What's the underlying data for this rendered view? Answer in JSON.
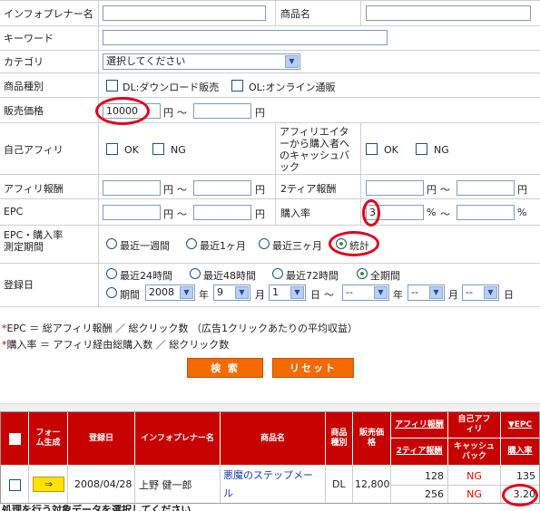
{
  "form": {
    "infopreneur_label": "インフォプレナー名",
    "product_label": "商品名",
    "keyword_label": "キーワード",
    "category_label": "カテゴリ",
    "category_value": "選択してください",
    "product_type_label": "商品種別",
    "product_type_dl": "DL:ダウンロード販売",
    "product_type_ol": "OL:オンライン通販",
    "price_label": "販売価格",
    "price_min": "10000",
    "yen": "円",
    "tilde": "〜",
    "self_affiliate_label": "自己アフィリ",
    "ok": "OK",
    "ng": "NG",
    "cashback_label": "アフィリエイターから購入者へのキャッシュバック",
    "affiliate_reward_label": "アフィリ報酬",
    "tier2_label": "2ティア報酬",
    "epc_label": "EPC",
    "purchase_rate_label": "購入率",
    "purchase_rate_min": "3",
    "percent": "%",
    "period_label": "EPC・購入率測定期間",
    "period_options": [
      "最近一週間",
      "最近1ヶ月",
      "最近三ヶ月",
      "統計"
    ],
    "reg_label": "登録日",
    "reg_options": [
      "最近24時間",
      "最近48時間",
      "最近72時間",
      "全期間"
    ],
    "range_label": "期間",
    "year_value": "2008",
    "year_unit": "年",
    "month_value": "9",
    "month_unit": "月",
    "day_value": "1",
    "day_unit": "日",
    "to_year": "--",
    "to_month": "--",
    "to_day": "--"
  },
  "notes": {
    "star": "*",
    "epc_note": "EPC ＝ 総アフィリ報酬 ／ 総クリック数 （広告1クリックあたりの平均収益）",
    "rate_note": "購入率 ＝ アフィリ経由総購入数 ／ 総クリック数"
  },
  "buttons": {
    "search": "検 索",
    "reset": "リセット"
  },
  "table": {
    "headers": {
      "form": "フォーム生成",
      "date": "登録日",
      "infopreneur": "インフォプレナー名",
      "product": "商品名",
      "type": "商品種別",
      "price": "販売価格",
      "affiliate_reward": "アフィリ報酬",
      "tier2": "2ティア報酬",
      "self_affiliate": "自己アフィリ",
      "cashback": "キャッシュバック",
      "epc": "▼EPC",
      "purchase_rate": "購入率"
    },
    "row": {
      "arrow": "⇒",
      "date": "2008/04/28",
      "infopreneur": "上野 健一郎",
      "product": "悪魔のステップメール",
      "type": "DL",
      "price": "12,800",
      "affiliate_reward": "128",
      "tier2": "256",
      "self_affiliate": "NG",
      "cashback": "NG",
      "epc": "135",
      "purchase_rate": "3.20"
    },
    "footer_text": "処理を行う対象データを選択してください"
  },
  "colors": {
    "accent": "#c70000",
    "button": "#f26a00",
    "highlight": "#e0001a"
  }
}
